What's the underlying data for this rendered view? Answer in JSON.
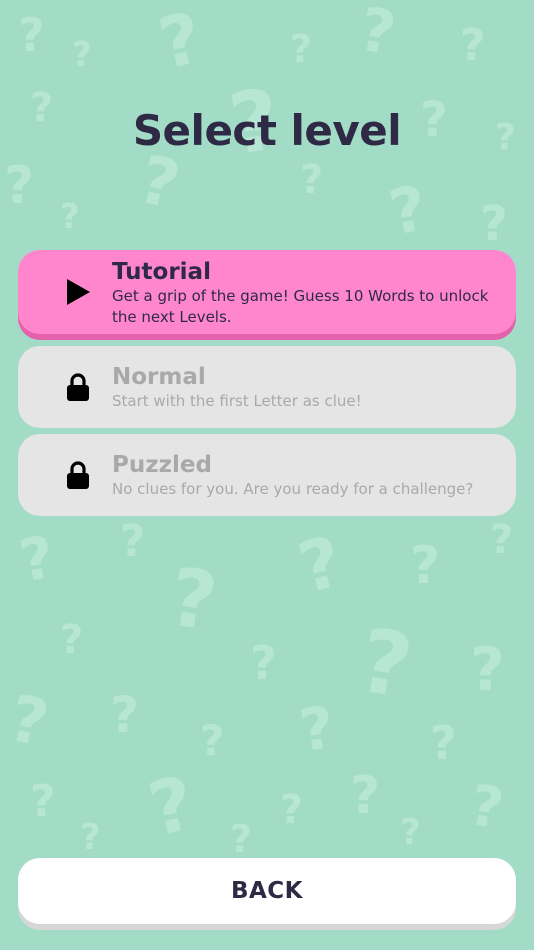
{
  "screen": {
    "title": "Select level"
  },
  "levels": [
    {
      "name": "Tutorial",
      "description": "Get a grip of the game! Guess 10 Words to unlock the next Levels.",
      "state": "unlocked",
      "icon": "play-icon"
    },
    {
      "name": "Normal",
      "description": "Start with the first Letter as clue!",
      "state": "locked",
      "icon": "lock-icon"
    },
    {
      "name": "Puzzled",
      "description": "No clues for you. Are you ready for a challenge?",
      "state": "locked",
      "icon": "lock-icon"
    }
  ],
  "footer": {
    "back_label": "BACK"
  },
  "colors": {
    "background": "#a3dcc6",
    "pattern": "#b7e6d4",
    "active_card": "#ff86cc",
    "locked_card": "#e5e5e5",
    "text_dark": "#2e2a45",
    "text_locked": "#a9a9a9"
  }
}
